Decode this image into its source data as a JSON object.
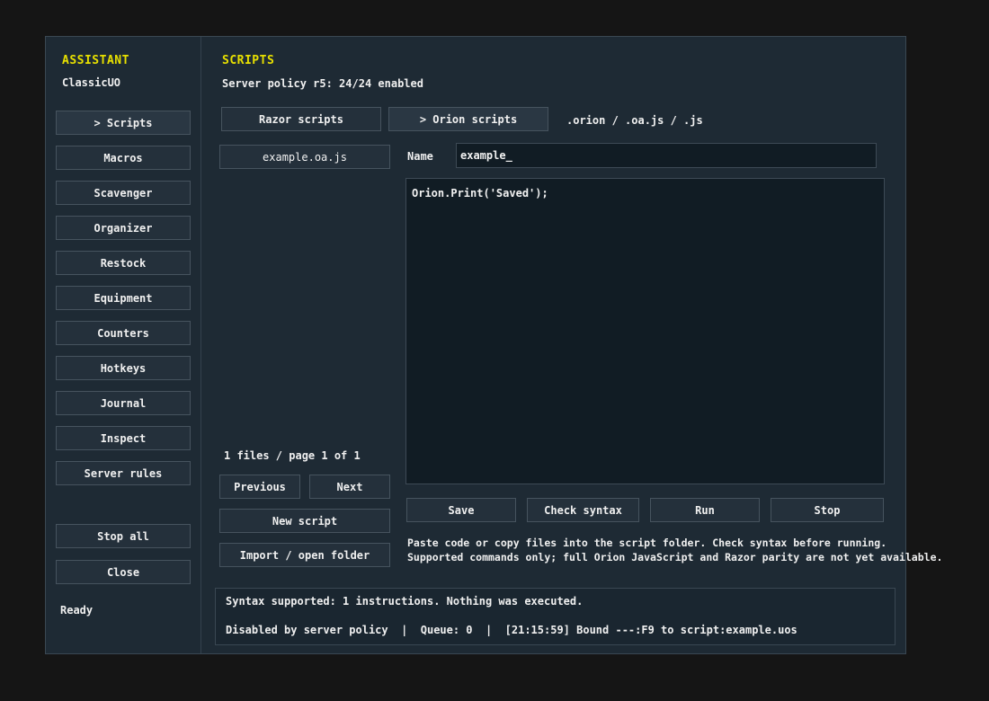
{
  "sidebar": {
    "title": "ASSISTANT",
    "subtitle": "ClassicUO",
    "items": [
      {
        "label": "> Scripts"
      },
      {
        "label": "Macros"
      },
      {
        "label": "Scavenger"
      },
      {
        "label": "Organizer"
      },
      {
        "label": "Restock"
      },
      {
        "label": "Equipment"
      },
      {
        "label": "Counters"
      },
      {
        "label": "Hotkeys"
      },
      {
        "label": "Journal"
      },
      {
        "label": "Inspect"
      },
      {
        "label": "Server rules"
      }
    ],
    "stop_all_label": "Stop all",
    "close_label": "Close",
    "status": "Ready"
  },
  "main": {
    "title": "SCRIPTS",
    "policy": "Server policy r5: 24/24 enabled",
    "tabs": [
      {
        "label": "Razor scripts"
      },
      {
        "label": "> Orion scripts"
      }
    ],
    "extensions": ".orion / .oa.js / .js",
    "files": [
      {
        "label": "example.oa.js"
      }
    ],
    "pagination": "1 files / page 1 of 1",
    "previous_label": "Previous",
    "next_label": "Next",
    "new_script_label": "New script",
    "import_label": "Import / open folder",
    "name_label": "Name",
    "name_value": "example_",
    "code": "Orion.Print('Saved');",
    "actions": {
      "save": "Save",
      "check_syntax": "Check syntax",
      "run": "Run",
      "stop": "Stop"
    },
    "help_line1": "Paste code or copy files into the script folder. Check syntax before running.",
    "help_line2": "Supported commands only; full Orion JavaScript and Razor parity are not yet available.",
    "status_line1": "Syntax supported: 1 instructions. Nothing was executed.",
    "status_line2": "Disabled by server policy  |  Queue: 0  |  [21:15:59] Bound ---:F9 to script:example.uos"
  },
  "colors": {
    "accent": "#e8e000",
    "background": "#1e2a34",
    "field": "#111c24"
  }
}
